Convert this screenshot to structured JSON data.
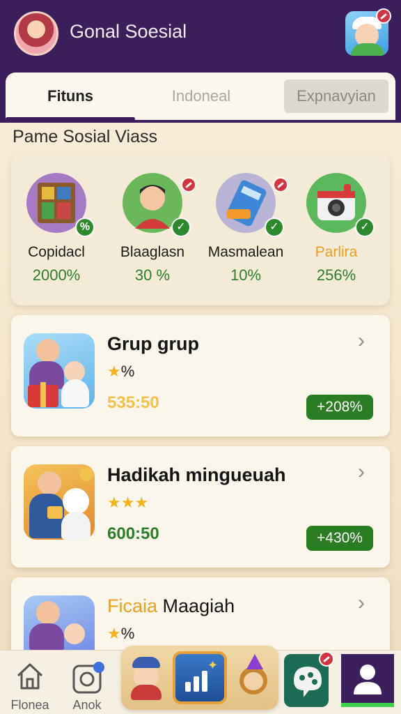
{
  "header": {
    "title": "Gonal Soesial"
  },
  "tabs": [
    {
      "label": "Fituns"
    },
    {
      "label": "Indoneal"
    },
    {
      "label": "Expnavyian"
    }
  ],
  "section_title": "Pame Sosial Viass",
  "stats": [
    {
      "name": "Copidacl",
      "value": "2000%",
      "check": "%",
      "icon": "board-game-icon"
    },
    {
      "name": "Blaaglasn",
      "value": "30 %",
      "check": "✓",
      "icon": "boy-avatar-icon"
    },
    {
      "name": "Masmalean",
      "value": "10%",
      "check": "✓",
      "icon": "calculator-icon"
    },
    {
      "name": "Parlira",
      "value": "256%",
      "check": "✓",
      "icon": "camera-icon"
    }
  ],
  "colors": {
    "header_bg": "#3b1f5a",
    "positive": "#2f7d2c",
    "badge_green": "#2a7d21",
    "gold": "#f3b21b",
    "amount_gold": "#f3c04b"
  },
  "cards": [
    {
      "title": "Grup grup",
      "stars": "★",
      "stars_suffix": "%",
      "amount": "535:50",
      "badge": "+208%"
    },
    {
      "title": "Hadikah mingueuah",
      "stars": "★★★",
      "stars_suffix": "",
      "amount": "600:50",
      "badge": "+430%"
    },
    {
      "title_highlight": "Ficaia",
      "title": "Maagiah",
      "stars": "★",
      "stars_suffix": "%"
    }
  ],
  "bottom_nav": [
    {
      "label": "Flonea",
      "icon": "home-icon"
    },
    {
      "label": "Anok",
      "icon": "square-notification-icon"
    }
  ]
}
